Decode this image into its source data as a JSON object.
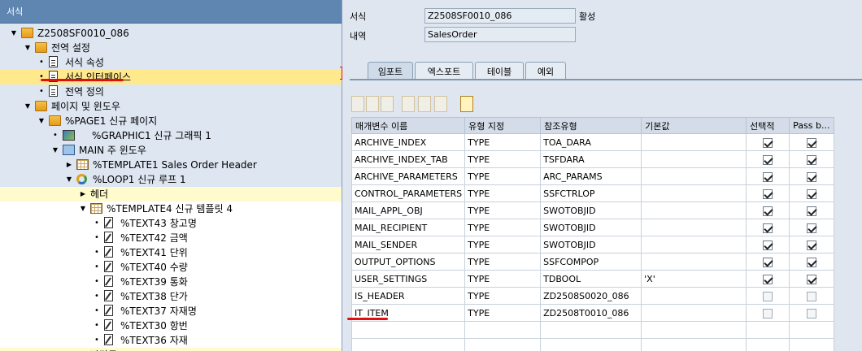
{
  "left_panel": {
    "header": "서식",
    "tree": [
      {
        "label": "Z2508SF0010_086",
        "icon": "folder-open-icon",
        "expander": "open",
        "level": 0,
        "bg": "blue"
      },
      {
        "label": "전역 설정",
        "icon": "folder-open-icon",
        "expander": "open",
        "level": 1,
        "bg": "blue"
      },
      {
        "label": "서식 속성",
        "icon": "document-icon",
        "expander": "leaf",
        "level": 2,
        "bg": "blue"
      },
      {
        "label": "서식 인터페이스",
        "icon": "document-icon",
        "expander": "leaf",
        "level": 2,
        "bg": "selected"
      },
      {
        "label": "전역 정의",
        "icon": "document-icon",
        "expander": "leaf",
        "level": 2,
        "bg": "blue"
      },
      {
        "label": "페이지 및 윈도우",
        "icon": "folder-open-icon",
        "expander": "open",
        "level": 1,
        "bg": "blue"
      },
      {
        "label": "%PAGE1 신규 페이지",
        "icon": "folder-open-icon",
        "expander": "open",
        "level": 2,
        "bg": "blue"
      },
      {
        "label": "%GRAPHIC1 신규 그래픽 1",
        "icon": "graphic-icon",
        "expander": "leaf",
        "level": 3,
        "bg": "blue"
      },
      {
        "label": "MAIN 주 윈도우",
        "icon": "window-icon",
        "expander": "open",
        "level": 3,
        "bg": "blue"
      },
      {
        "label": "%TEMPLATE1 Sales Order Header",
        "icon": "template-icon",
        "expander": "closed",
        "level": 4,
        "bg": "blue"
      },
      {
        "label": "%LOOP1 신규 루프 1",
        "icon": "loop-icon",
        "expander": "open",
        "level": 4,
        "bg": "blue"
      },
      {
        "label": "헤더",
        "icon": "",
        "expander": "closed",
        "level": 5,
        "bg": "yellow"
      },
      {
        "label": "%TEMPLATE4 신규 템플릿 4",
        "icon": "template-icon",
        "expander": "open",
        "level": 5,
        "bg": "white"
      },
      {
        "label": "%TEXT43 창고명",
        "icon": "text-node-icon",
        "expander": "leaf",
        "level": 6,
        "bg": "white"
      },
      {
        "label": "%TEXT42 금액",
        "icon": "text-node-icon",
        "expander": "leaf",
        "level": 6,
        "bg": "white"
      },
      {
        "label": "%TEXT41 단위",
        "icon": "text-node-icon",
        "expander": "leaf",
        "level": 6,
        "bg": "white"
      },
      {
        "label": "%TEXT40 수량",
        "icon": "text-node-icon",
        "expander": "leaf",
        "level": 6,
        "bg": "white"
      },
      {
        "label": "%TEXT39 통화",
        "icon": "text-node-icon",
        "expander": "leaf",
        "level": 6,
        "bg": "white"
      },
      {
        "label": "%TEXT38 단가",
        "icon": "text-node-icon",
        "expander": "leaf",
        "level": 6,
        "bg": "white"
      },
      {
        "label": "%TEXT37 자재명",
        "icon": "text-node-icon",
        "expander": "leaf",
        "level": 6,
        "bg": "white"
      },
      {
        "label": "%TEXT30 항번",
        "icon": "text-node-icon",
        "expander": "leaf",
        "level": 6,
        "bg": "white"
      },
      {
        "label": "%TEXT36 자재",
        "icon": "text-node-icon",
        "expander": "leaf",
        "level": 6,
        "bg": "white"
      },
      {
        "label": "바닥글",
        "icon": "",
        "expander": "closed",
        "level": 5,
        "bg": "yellow"
      }
    ]
  },
  "header_fields": {
    "form_label": "서식",
    "form_value": "Z2508SF0010_086",
    "status": "활성",
    "desc_label": "내역",
    "desc_value": "SalesOrder"
  },
  "tabs": [
    {
      "label": "임포트",
      "active": true
    },
    {
      "label": "엑스포트",
      "active": false
    },
    {
      "label": "테이블",
      "active": false
    },
    {
      "label": "예외",
      "active": false
    }
  ],
  "toolbar": [
    {
      "icon": "cut-icon",
      "enabled": false
    },
    {
      "icon": "copy-icon",
      "enabled": false
    },
    {
      "icon": "paste-icon",
      "enabled": false
    },
    {
      "icon": "insert-row-icon",
      "enabled": false
    },
    {
      "icon": "append-row-icon",
      "enabled": false
    },
    {
      "icon": "delete-row-icon",
      "enabled": false
    },
    {
      "icon": "check-icon",
      "enabled": true
    }
  ],
  "table": {
    "columns": [
      "매개변수 이름",
      "유형 지정",
      "참조유형",
      "기본값",
      "선택적",
      "Pass b..."
    ],
    "rows": [
      {
        "name": "ARCHIVE_INDEX",
        "type": "TYPE",
        "ref": "TOA_DARA",
        "default": "",
        "optional": true,
        "pass": true
      },
      {
        "name": "ARCHIVE_INDEX_TAB",
        "type": "TYPE",
        "ref": "TSFDARA",
        "default": "",
        "optional": true,
        "pass": true
      },
      {
        "name": "ARCHIVE_PARAMETERS",
        "type": "TYPE",
        "ref": "ARC_PARAMS",
        "default": "",
        "optional": true,
        "pass": true
      },
      {
        "name": "CONTROL_PARAMETERS",
        "type": "TYPE",
        "ref": "SSFCTRLOP",
        "default": "",
        "optional": true,
        "pass": true
      },
      {
        "name": "MAIL_APPL_OBJ",
        "type": "TYPE",
        "ref": "SWOTOBJID",
        "default": "",
        "optional": true,
        "pass": true
      },
      {
        "name": "MAIL_RECIPIENT",
        "type": "TYPE",
        "ref": "SWOTOBJID",
        "default": "",
        "optional": true,
        "pass": true
      },
      {
        "name": "MAIL_SENDER",
        "type": "TYPE",
        "ref": "SWOTOBJID",
        "default": "",
        "optional": true,
        "pass": true
      },
      {
        "name": "OUTPUT_OPTIONS",
        "type": "TYPE",
        "ref": "SSFCOMPOP",
        "default": "",
        "optional": true,
        "pass": true
      },
      {
        "name": "USER_SETTINGS",
        "type": "TYPE",
        "ref": "TDBOOL",
        "default": "'X'",
        "optional": true,
        "pass": true
      },
      {
        "name": "IS_HEADER",
        "type": "TYPE",
        "ref": "ZD2508S0020_086",
        "default": "",
        "optional": false,
        "pass": false
      },
      {
        "name": "IT_ITEM",
        "type": "TYPE",
        "ref": "ZD2508T0010_086",
        "default": "",
        "optional": false,
        "pass": false
      },
      {
        "name": "",
        "type": "",
        "ref": "",
        "default": "",
        "optional": false,
        "pass": false
      },
      {
        "name": "",
        "type": "",
        "ref": "",
        "default": "",
        "optional": false,
        "pass": false
      }
    ]
  },
  "colors": {
    "selection": "#ffe98c",
    "yellow_row": "#fffbcc",
    "header_blue": "#5e86b1",
    "red_marker": "#e01010"
  }
}
